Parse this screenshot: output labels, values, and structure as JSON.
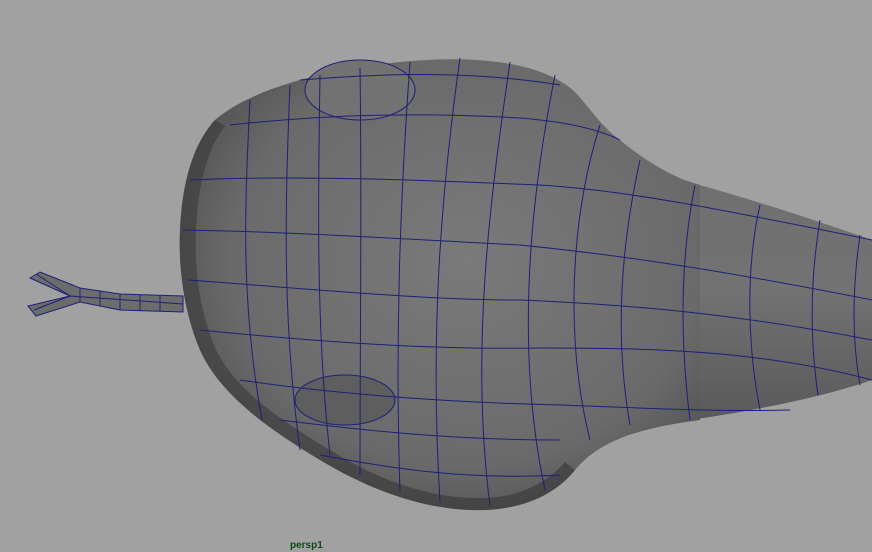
{
  "viewport": {
    "camera_name": "persp1",
    "background_color": "#a1a1a1",
    "wireframe_color": "#1e1f7a",
    "surface_shading": "grey-shaded",
    "camera_label_color": "#0b4a12"
  }
}
